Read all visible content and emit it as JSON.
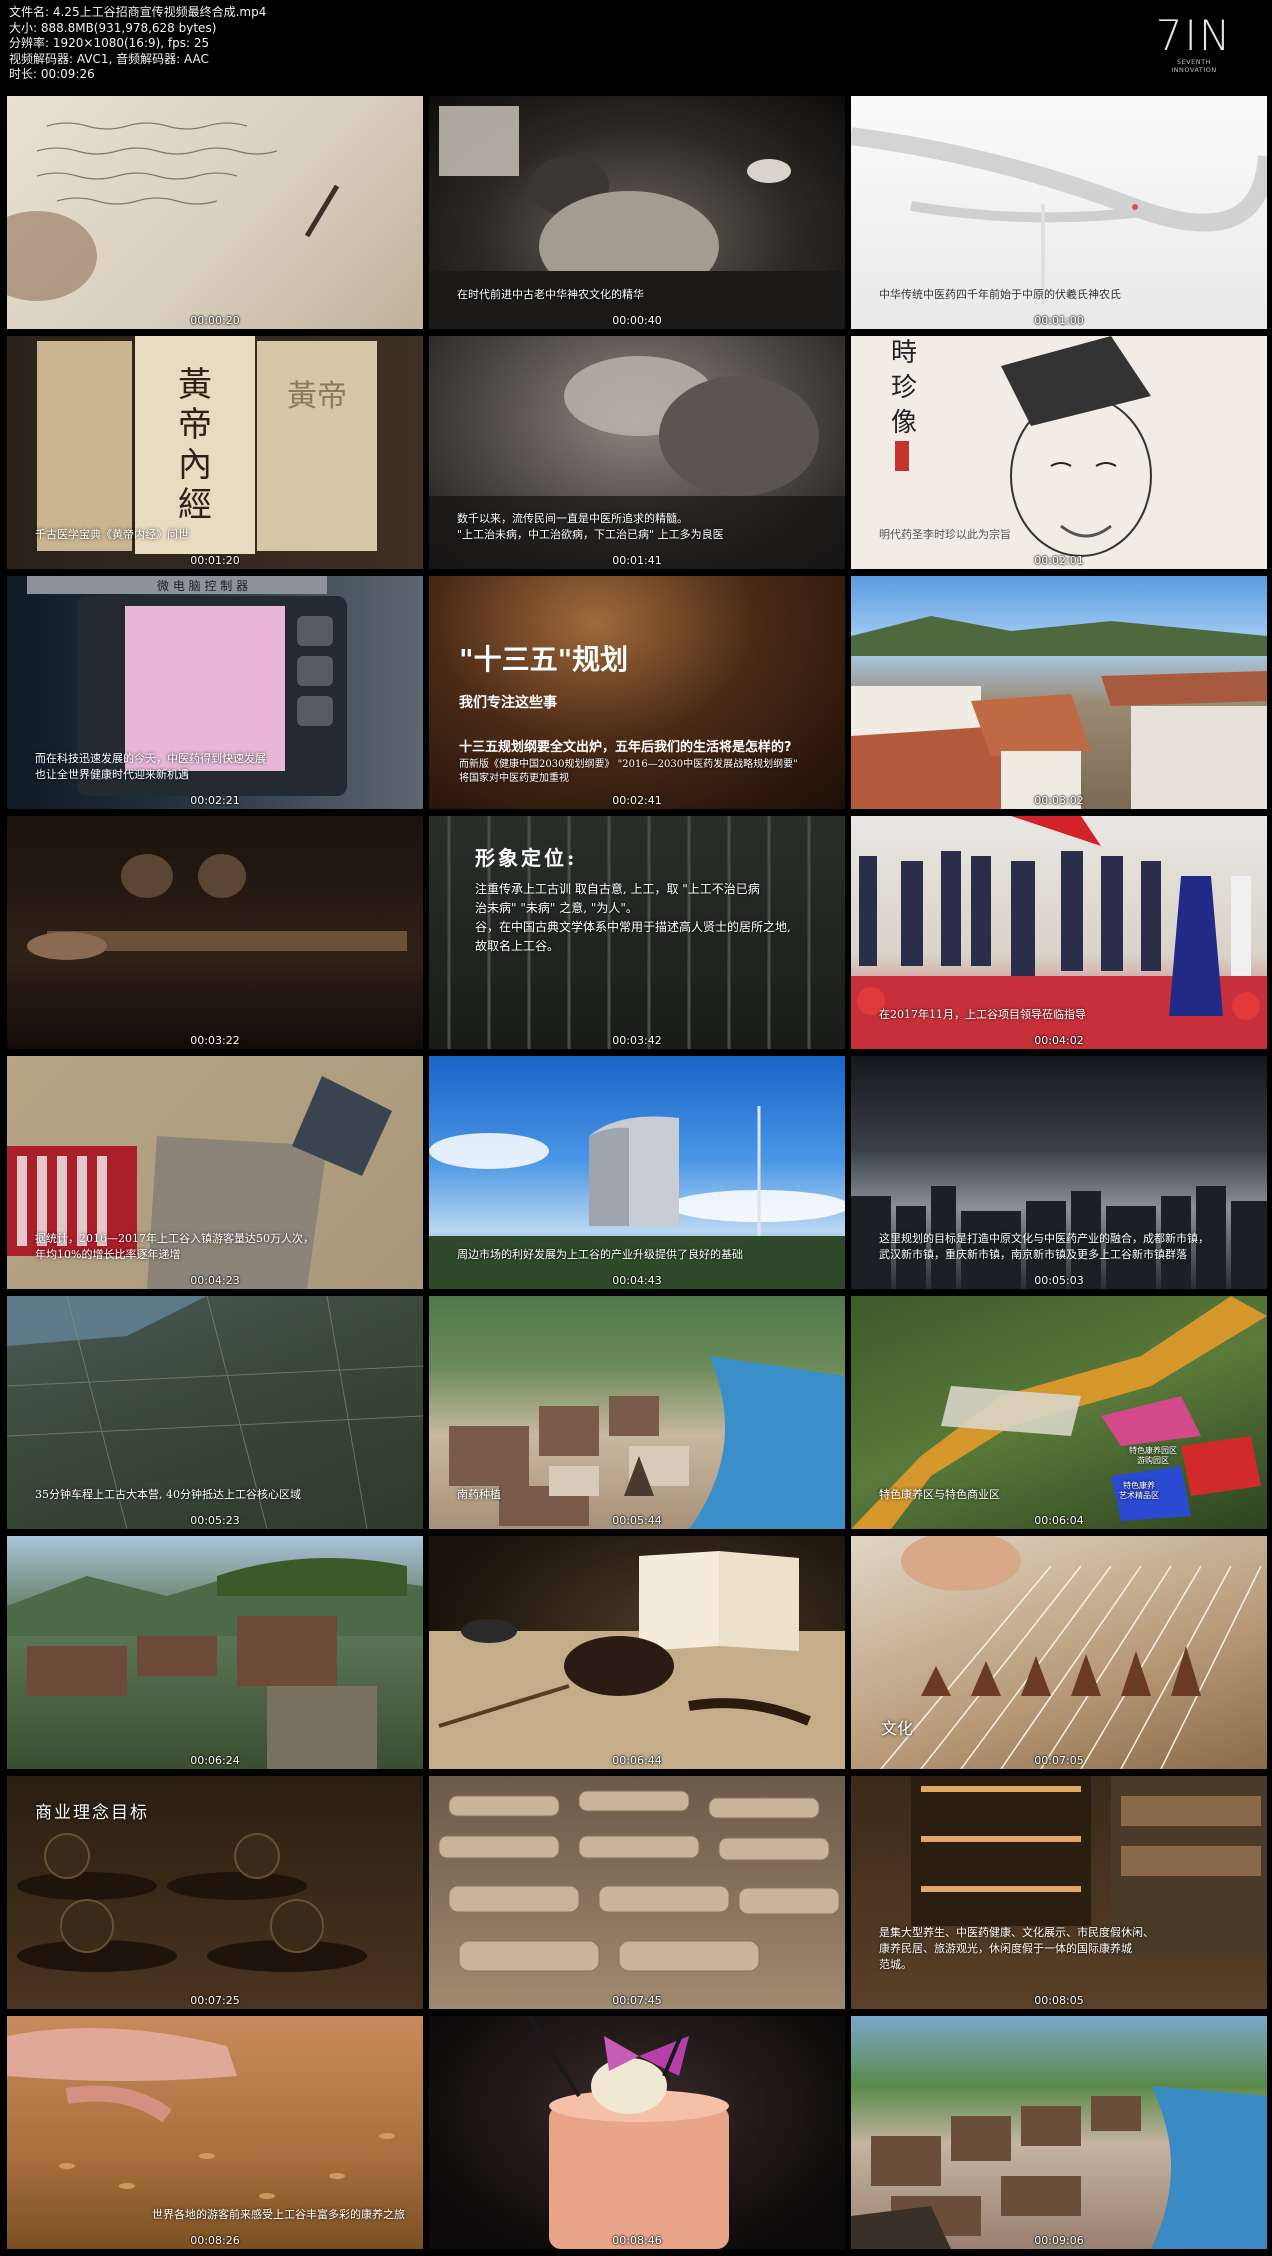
{
  "file_info": {
    "filename": "文件名: 4.25上工谷招商宣传视频最终合成.mp4",
    "size": "大小: 888.8MB(931,978,628 bytes)",
    "resolution": "分辨率: 1920×1080(16:9), fps: 25",
    "codec": "视频解码器: AVC1, 音频解码器: AAC",
    "duration": "时长: 00:09:26"
  },
  "logo": {
    "mark": "7IN",
    "sub1": "SEVENTH",
    "sub2": "INNOVATION"
  },
  "thumbnails": [
    {
      "ts": "00:00:20",
      "caption": ""
    },
    {
      "ts": "00:00:40",
      "caption": "在时代前进中古老中华神农文化的精华"
    },
    {
      "ts": "00:01:00",
      "caption": "中华传统中医药四千年前始于中原的伏羲氏神农氏"
    },
    {
      "ts": "00:01:20",
      "caption": "千古医学宝典《黄帝内经》问世"
    },
    {
      "ts": "00:01:41",
      "caption": "数千以来，流传民间一直是中医所追求的精髓。\n\"上工治未病，中工治欲病，下工治已病\" 上工多为良医"
    },
    {
      "ts": "00:02:01",
      "caption": "明代药圣李时珍以此为宗旨"
    },
    {
      "ts": "00:02:21",
      "caption": "而在科技迅速发展的今天，中医药得到快速发展\n也让全世界健康时代迎来新机遇"
    },
    {
      "ts": "00:02:41",
      "caption": "",
      "title": "\"十三五\"规划",
      "subtitle": "我们专注这些事",
      "subtitle2": "十三五规划纲要全文出炉，五年后我们的生活将是怎样的?",
      "caption2": "而新版《健康中国2030规划纲要》 \"2016—2030中医药发展战略规划纲要\"\n将国家对中医药更加重视"
    },
    {
      "ts": "00:03:02",
      "caption": ""
    },
    {
      "ts": "00:03:22",
      "caption": ""
    },
    {
      "ts": "00:03:42",
      "caption": "",
      "title": "形象定位:",
      "body": "注重传承上工古训 取自古意, 上工，取 \"上工不治已病\n治未病\" \"未病\" 之意, \"为人\"。\n谷，在中国古典文学体系中常用于描述高人贤士的居所之地,\n故取名上工谷。"
    },
    {
      "ts": "00:04:02",
      "caption": "在2017年11月，上工谷项目领导莅临指导"
    },
    {
      "ts": "00:04:23",
      "caption": "据统计，2016—2017年上工谷入镇游客量达50万人次，\n年均10%的增长比率逐年递增"
    },
    {
      "ts": "00:04:43",
      "caption": "周边市场的利好发展为上工谷的产业升级提供了良好的基础"
    },
    {
      "ts": "00:05:03",
      "caption": "这里规划的目标是打造中原文化与中医药产业的融合，成都新市镇，\n武汉新市镇，重庆新市镇，南京新市镇及更多上工谷新市镇群落"
    },
    {
      "ts": "00:05:23",
      "caption": "35分钟车程上工古大本营, 40分钟抵达上工谷核心区域"
    },
    {
      "ts": "00:05:44",
      "caption": "南药种植"
    },
    {
      "ts": "00:06:04",
      "caption": "特色康养区与特色商业区",
      "tag1": "特色康养园区\n游购园区",
      "tag2": "特色康养\n艺术精品区"
    },
    {
      "ts": "00:06:24",
      "caption": ""
    },
    {
      "ts": "00:06:44",
      "caption": ""
    },
    {
      "ts": "00:07:05",
      "caption": "文化"
    },
    {
      "ts": "00:07:25",
      "caption": "",
      "title": "商业理念目标"
    },
    {
      "ts": "00:07:45",
      "caption": ""
    },
    {
      "ts": "00:08:05",
      "caption": "是集大型养生、中医药健康、文化展示、市民度假休闲、\n康养民居、旅游观光，休闲度假于一体的国际康养城\n范城。"
    },
    {
      "ts": "00:08:26",
      "caption": "世界各地的游客前来感受上工谷丰富多彩的康养之旅"
    },
    {
      "ts": "00:08:46",
      "caption": ""
    },
    {
      "ts": "00:09:06",
      "caption": ""
    }
  ]
}
